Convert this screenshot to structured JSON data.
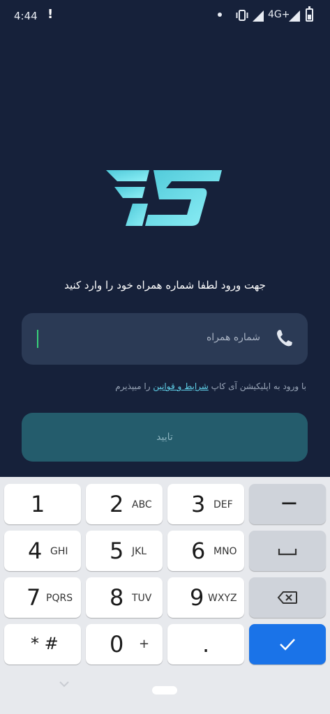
{
  "status_bar": {
    "time": "4:44",
    "alert": "!",
    "network": "4G+"
  },
  "login": {
    "prompt": "جهت ورود لطفا شماره همراه خود را وارد کنید",
    "phone_placeholder": "شماره همراه",
    "terms_prefix": "با ورود به اپلیکیشن آی کاپ ",
    "terms_link": "شرایط و قوانین",
    "terms_suffix": " را میپذیرم",
    "confirm_label": "تایید"
  },
  "keyboard": {
    "keys": [
      {
        "num": "1",
        "letters": ""
      },
      {
        "num": "2",
        "letters": "ABC"
      },
      {
        "num": "3",
        "letters": "DEF"
      },
      {
        "num": "4",
        "letters": "GHI"
      },
      {
        "num": "5",
        "letters": "JKL"
      },
      {
        "num": "6",
        "letters": "MNO"
      },
      {
        "num": "7",
        "letters": "PQRS"
      },
      {
        "num": "8",
        "letters": "TUV"
      },
      {
        "num": "9",
        "letters": "WXYZ"
      },
      {
        "num": "* #",
        "letters": ""
      },
      {
        "num": "0",
        "letters": "+"
      },
      {
        "num": ".",
        "letters": ""
      }
    ],
    "minus": "−"
  },
  "colors": {
    "background": "#16213a",
    "field": "#2b3a55",
    "confirm": "#245c6c",
    "logo": "#6fe0ef",
    "accent_link": "#5fd0e8",
    "keyboard_done": "#1a73e8"
  }
}
